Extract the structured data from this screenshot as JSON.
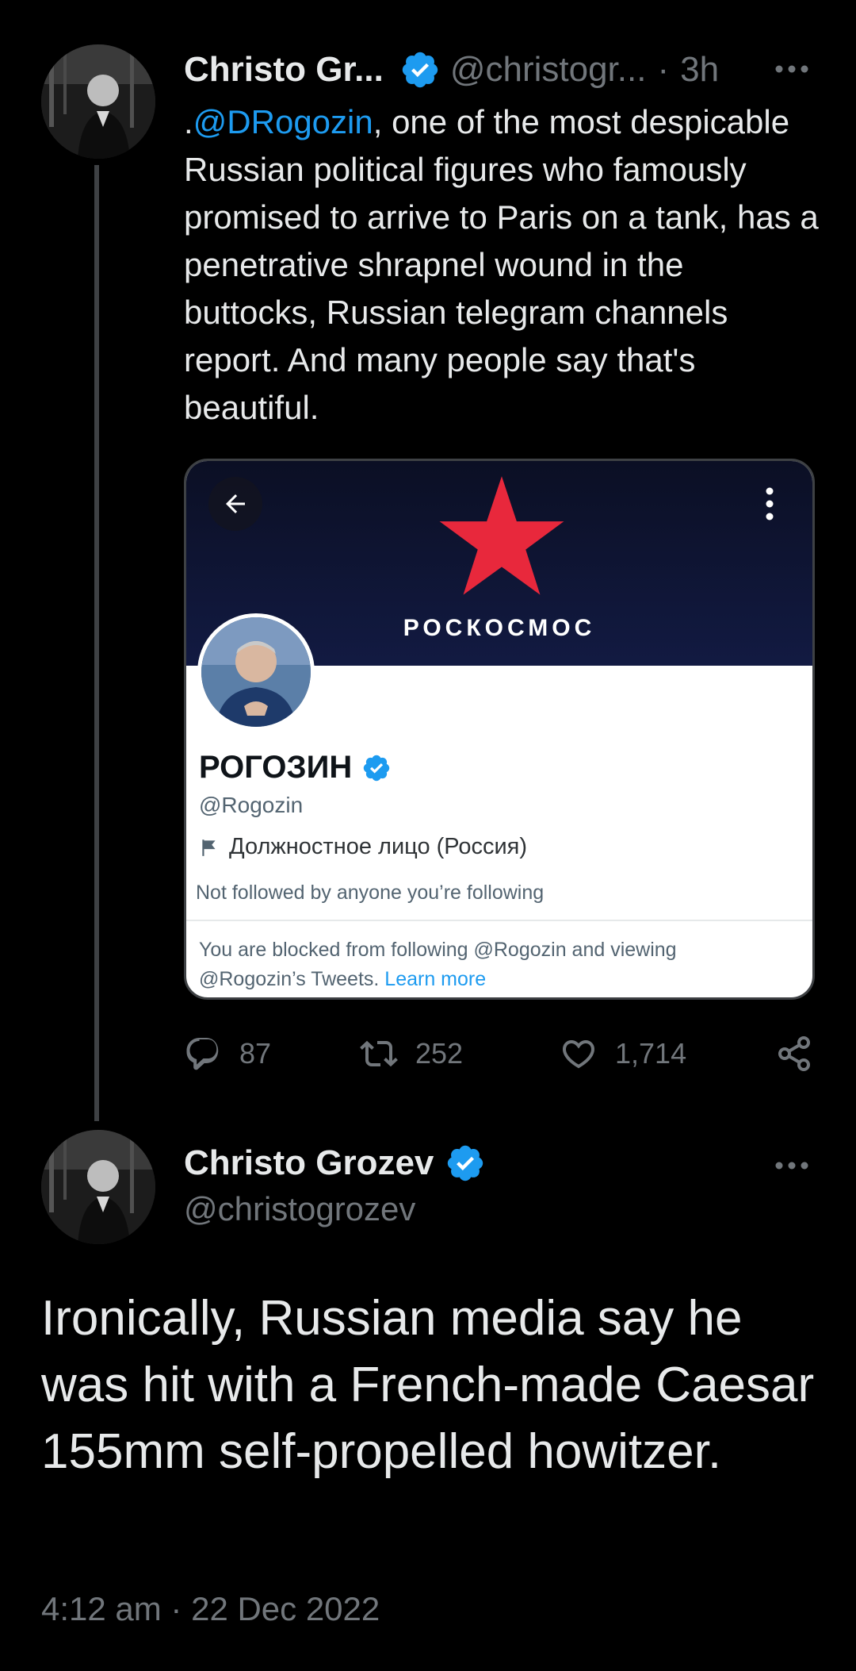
{
  "colors": {
    "background": "#000000",
    "text_primary": "#e7e9ea",
    "text_secondary": "#71767b",
    "accent": "#1d9bf0",
    "thread_line": "#3e4144",
    "roscosmos_star": "#e8283c"
  },
  "tweet1": {
    "author_name": "Christo Gr...",
    "handle": "@christogr...",
    "separator": "·",
    "time": "3h",
    "more_icon": "more-horizontal-icon",
    "text_prefix": ".",
    "mention": "@DRogozin",
    "text_rest": ", one of the most despicable Russian political figures who famously promised to arrive to Paris on a tank, has a penetrative shrapnel wound in the buttocks, Russian telegram channels report. And many people say that's beautiful.",
    "embedded_screenshot": {
      "banner_text": "РОСКОСМОС",
      "profile_name": "РОГОЗИН",
      "profile_handle": "@Rogozin",
      "profile_label": "Должностное лицо (Россия)",
      "follow_info": "Not followed by anyone you’re following",
      "blocked_text": "You are blocked from following @Rogozin and viewing @Rogozin’s Tweets.",
      "learn_more": "Learn more"
    },
    "actions": {
      "replies": "87",
      "retweets": "252",
      "likes": "1,714"
    }
  },
  "tweet2": {
    "author_name": "Christo Grozev",
    "handle": "@christogrozev",
    "more_icon": "more-horizontal-icon",
    "text": "Ironically, Russian media say he was hit with a French-made Caesar 155mm self-propelled howitzer.",
    "timestamp": "4:12 am · 22 Dec 2022"
  }
}
